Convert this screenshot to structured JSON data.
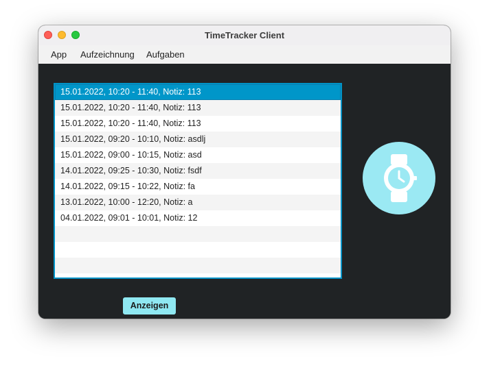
{
  "window": {
    "title": "TimeTracker Client"
  },
  "menu": {
    "items": [
      {
        "label": "App"
      },
      {
        "label": "Aufzeichnung"
      },
      {
        "label": "Aufgaben"
      }
    ]
  },
  "entries": {
    "items": [
      {
        "text": "15.01.2022, 10:20 - 11:40, Notiz: 113",
        "selected": true
      },
      {
        "text": "15.01.2022, 10:20 - 11:40, Notiz: 113"
      },
      {
        "text": "15.01.2022, 10:20 - 11:40, Notiz: 113"
      },
      {
        "text": "15.01.2022, 09:20 - 10:10, Notiz: asdlj"
      },
      {
        "text": "15.01.2022, 09:00 - 10:15, Notiz: asd"
      },
      {
        "text": "14.01.2022, 09:25 - 10:30, Notiz: fsdf"
      },
      {
        "text": "14.01.2022, 09:15 - 10:22, Notiz: fa"
      },
      {
        "text": "13.01.2022, 10:00 - 12:20, Notiz: a"
      },
      {
        "text": "04.01.2022, 09:01 - 10:01, Notiz: 12"
      }
    ]
  },
  "icon": {
    "name": "watch-icon",
    "color": "#9be9f3"
  },
  "buttons": {
    "show_label": "Anzeigen"
  },
  "colors": {
    "accent": "#0096c9",
    "background": "#202325",
    "button": "#8fe8f2"
  }
}
